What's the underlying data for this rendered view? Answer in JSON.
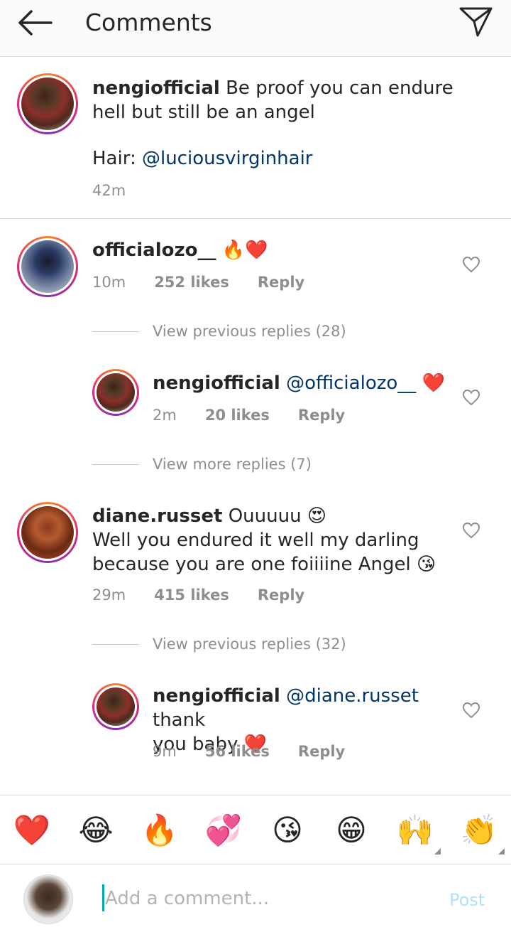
{
  "header": {
    "title": "Comments"
  },
  "caption": {
    "username": "nengiofficial",
    "text": "Be proof you can endure hell but still be an angel",
    "hair_label": "Hair:",
    "hair_mention": "@luciousvirginhair",
    "time": "42m"
  },
  "comments": [
    {
      "username": "officialozo__",
      "text": "🔥❤️",
      "time": "10m",
      "likes": "252 likes",
      "reply": "Reply",
      "view_previous": "View previous replies (28)",
      "replies": [
        {
          "username": "nengiofficial",
          "mention": "@officialozo__",
          "text": "❤️",
          "time": "2m",
          "likes": "20 likes",
          "reply": "Reply"
        }
      ],
      "view_more": "View more replies (7)"
    },
    {
      "username": "diane.russet",
      "text_line1": "Ouuuuu 😍",
      "text_line2": "Well you endured it well my darling",
      "text_line3": "because you are one foiiiine Angel 😘",
      "time": "29m",
      "likes": "415 likes",
      "reply": "Reply",
      "view_previous": "View previous replies (32)",
      "replies": [
        {
          "username": "nengiofficial",
          "mention": "@diane.russet",
          "text_line1": "thank",
          "text_line2": "you baby ❤️",
          "time": "9m",
          "likes": "56 likes",
          "reply": "Reply"
        }
      ]
    }
  ],
  "quick_emojis": [
    "❤️",
    "😂",
    "🔥",
    "💞",
    "😘",
    "😁",
    "🙌",
    "👏"
  ],
  "composer": {
    "placeholder": "Add a comment...",
    "post_label": "Post"
  }
}
